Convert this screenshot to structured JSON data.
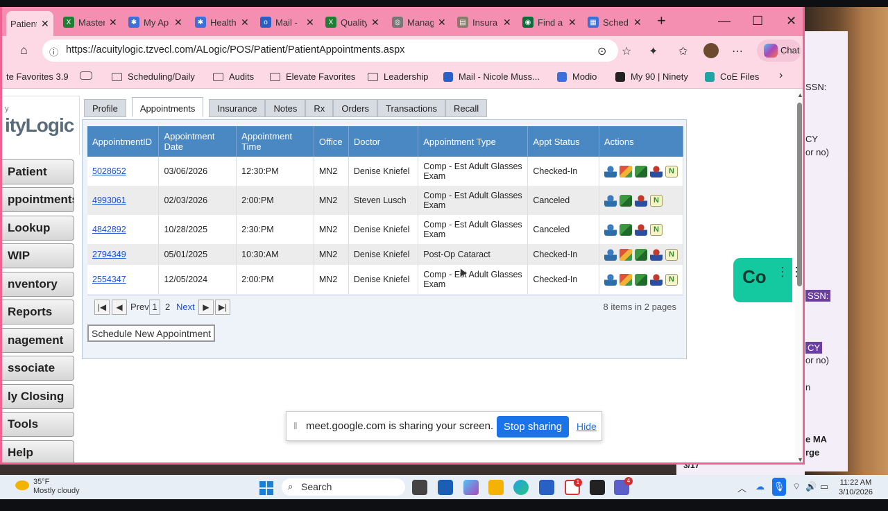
{
  "browser_tabs": [
    {
      "label": "Patient",
      "color": "#4a88c3"
    },
    {
      "label": "Master",
      "color": "#1e7e34"
    },
    {
      "label": "My Ap",
      "color": "#3d6fd6"
    },
    {
      "label": "Health",
      "color": "#3d6fd6"
    },
    {
      "label": "Mail -",
      "color": "#2a5fc4"
    },
    {
      "label": "Quality",
      "color": "#1e7e34"
    },
    {
      "label": "Manag",
      "color": "#777777"
    },
    {
      "label": "Insura",
      "color": "#8a7a6a"
    },
    {
      "label": "Find a",
      "color": "#0b6b3a"
    },
    {
      "label": "Sched",
      "color": "#3d6fd6"
    }
  ],
  "address": {
    "url": "https://acuitylogic.tzvecl.com/ALogic/POS/Patient/PatientAppointments.aspx",
    "chat_label": "Chat"
  },
  "favorites": [
    "te Favorites 3.9",
    "Scheduling/Daily",
    "Audits",
    "Elevate Favorites",
    "Leadership",
    "Mail - Nicole Muss...",
    "Modio",
    "My 90 | Ninety",
    "CoE Files"
  ],
  "logo": {
    "text": "ityLogic",
    "sub": "y"
  },
  "side_menu": [
    "Patient",
    "ppointments",
    "Lookup",
    " WIP",
    "nventory",
    "Reports",
    "nagement",
    "ssociate",
    "ly Closing",
    "Tools",
    "Help"
  ],
  "page_tabs": [
    "Profile",
    "Appointments",
    "Insurance",
    "Notes",
    "Rx",
    "Orders",
    "Transactions",
    "Recall"
  ],
  "active_tab": "Appointments",
  "table": {
    "headers": [
      "AppointmentID",
      "Appointment Date",
      "Appointment Time",
      "Office",
      "Doctor",
      "Appointment Type",
      "Appt Status",
      "Actions"
    ],
    "rows": [
      {
        "id": "5028652",
        "date": "03/06/2026",
        "time": "12:30:PM",
        "office": "MN2",
        "doctor": "Denise Kniefel",
        "type": "Comp - Est Adult Glasses Exam",
        "status": "Checked-In",
        "actions": [
          "user",
          "arrow",
          "check",
          "red",
          "note"
        ]
      },
      {
        "id": "4993061",
        "date": "02/03/2026",
        "time": "2:00:PM",
        "office": "MN2",
        "doctor": "Steven Lusch",
        "type": "Comp - Est Adult Glasses Exam",
        "status": "Canceled",
        "actions": [
          "user",
          "check",
          "red",
          "note"
        ]
      },
      {
        "id": "4842892",
        "date": "10/28/2025",
        "time": "2:30:PM",
        "office": "MN2",
        "doctor": "Denise Kniefel",
        "type": "Comp - Est Adult Glasses Exam",
        "status": "Canceled",
        "actions": [
          "user",
          "check",
          "red",
          "note"
        ]
      },
      {
        "id": "2794349",
        "date": "05/01/2025",
        "time": "10:30:AM",
        "office": "MN2",
        "doctor": "Denise Kniefel",
        "type": "Post-Op Cataract",
        "status": "Checked-In",
        "actions": [
          "user",
          "arrow",
          "check",
          "red",
          "note"
        ]
      },
      {
        "id": "2554347",
        "date": "12/05/2024",
        "time": "2:00:PM",
        "office": "MN2",
        "doctor": "Denise Kniefel",
        "type": "Comp - Est Adult Glasses Exam",
        "status": "Checked-In",
        "actions": [
          "user",
          "arrow",
          "check",
          "red",
          "note"
        ]
      }
    ]
  },
  "pager": {
    "prev": "Prev",
    "page1": "1",
    "page2": "2",
    "next": "Next",
    "summary": "8 items in 2 pages"
  },
  "schedule_button": "Schedule New Appointment",
  "share_bar": {
    "message": "meet.google.com is sharing your screen.",
    "stop": "Stop sharing",
    "hide": "Hide"
  },
  "co_widget": "Co",
  "background_doc": {
    "l1": "SSN:",
    "l2": "CY",
    "l3": "or no)",
    "l4": "SSN:",
    "l5": "CY",
    "l6": "or no)",
    "l7": "n",
    "l8": "e MA",
    "l9": "rge",
    "page": "3/17"
  },
  "taskbar": {
    "temp": "35°F",
    "weather": "Mostly cloudy",
    "search": "Search",
    "time": "11:22 AM",
    "date": "3/10/2026",
    "badge1": "1",
    "badge2": "4"
  }
}
